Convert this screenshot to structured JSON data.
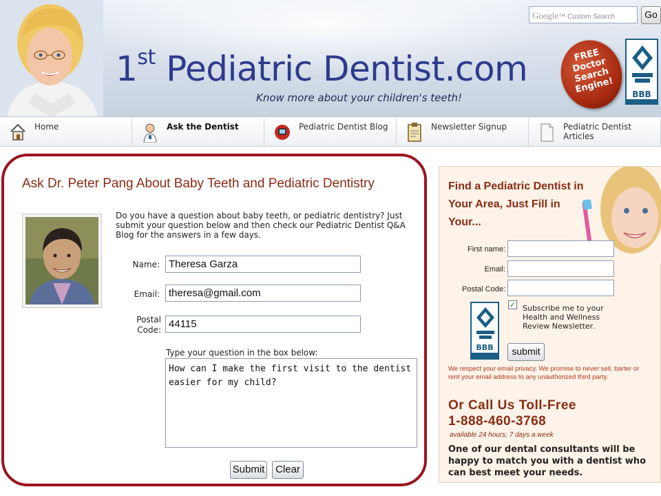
{
  "header": {
    "site_title_sup": "st",
    "site_title_prefix": "1",
    "site_title_main": "Pediatric Dentist.com",
    "tagline": "Know more about your children's teeth!",
    "search": {
      "brand": "Google",
      "placeholder": "Custom Search",
      "button_label": "Go"
    },
    "badge_lines": [
      "FREE",
      "Doctor",
      "Search",
      "Engine!"
    ],
    "bbb_label": "BBB"
  },
  "nav": {
    "items": [
      {
        "label": "Home",
        "icon": "home-icon"
      },
      {
        "label": "Ask the Dentist",
        "icon": "dentist-icon",
        "active": true
      },
      {
        "label": "Pediatric Dentist Blog",
        "icon": "blog-icon"
      },
      {
        "label": "Newsletter Signup",
        "icon": "clipboard-icon"
      },
      {
        "label": "Pediatric Dentist Articles",
        "icon": "article-icon"
      }
    ]
  },
  "form": {
    "title": "Ask Dr. Peter Pang About Baby Teeth and Pediatric Dentistry",
    "intro": "Do you have a question about baby teeth, or pediatric dentistry? Just submit your question below and then check our Pediatric Dentist Q&A Blog for the answers in a few days.",
    "name_label": "Name:",
    "name_value": "Theresa Garza",
    "email_label": "Email:",
    "email_value": "theresa@gmail.com",
    "postal_label_line1": "Postal",
    "postal_label_line2": "Code:",
    "postal_value": "44115",
    "question_label": "Type your question in the box below:",
    "question_value": "How can I make the first visit to the dentist easier for my child?",
    "submit_label": "Submit",
    "clear_label": "Clear"
  },
  "sidebar": {
    "find_title": "Find a Pediatric Dentist in Your Area, Just Fill in Your...",
    "first_name_label": "First name:",
    "email_label": "Email:",
    "postal_label": "Postal Code:",
    "subscribe_checked": true,
    "subscribe_text": "Subscribe me to your Health and Wellness Review Newsletter.",
    "bbb_label": "BBB",
    "submit_label": "submit",
    "privacy": "We respect your email privacy. We promise to never sell, barter or rent your email address to any unauthorized third party.",
    "call_title": "Or Call Us Toll-Free",
    "phone": "1-888-460-3768",
    "availability": "available 24 hours, 7 days a week",
    "consultants": "One of our dental consultants will be happy to match you with a dentist who can best meet your needs."
  },
  "colors": {
    "brand_blue": "#2e3a8c",
    "title_red": "#8a2c14",
    "panel_border": "#9b1420",
    "sidebar_bg": "#fdf3e8"
  }
}
